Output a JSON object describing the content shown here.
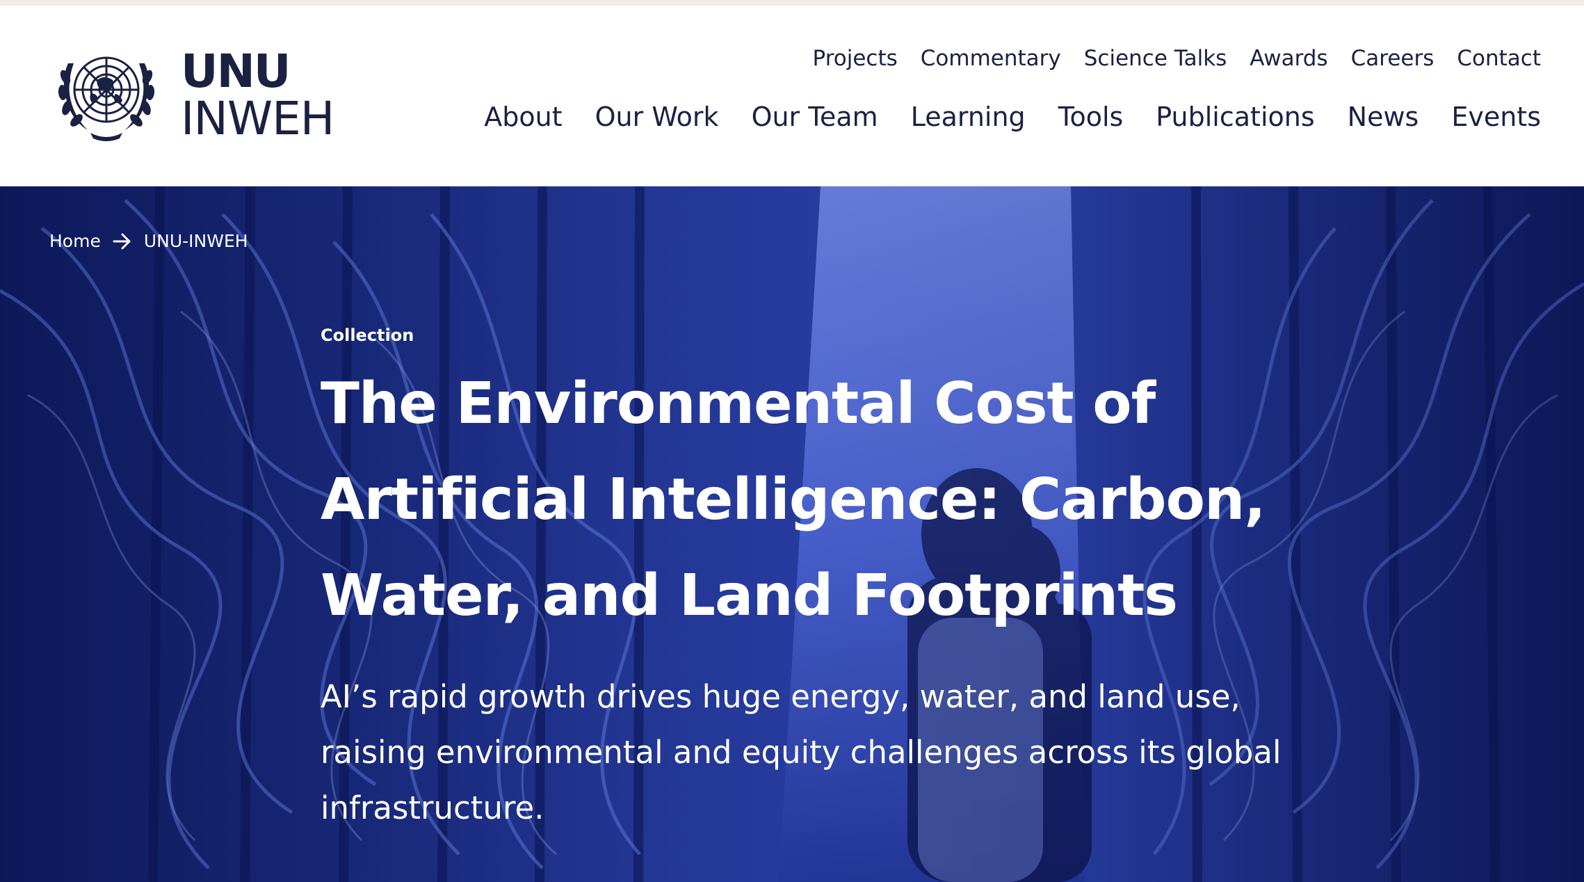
{
  "header": {
    "logo": {
      "line1": "UNU",
      "line2": "INWEH",
      "emblem_icon": "un-emblem-icon"
    },
    "utility_nav": [
      {
        "label": "Projects"
      },
      {
        "label": "Commentary"
      },
      {
        "label": "Science Talks"
      },
      {
        "label": "Awards"
      },
      {
        "label": "Careers"
      },
      {
        "label": "Contact"
      }
    ],
    "main_nav": [
      {
        "label": "About"
      },
      {
        "label": "Our Work"
      },
      {
        "label": "Our Team"
      },
      {
        "label": "Learning"
      },
      {
        "label": "Tools"
      },
      {
        "label": "Publications"
      },
      {
        "label": "News"
      },
      {
        "label": "Events"
      }
    ]
  },
  "hero": {
    "breadcrumb": [
      {
        "label": "Home"
      },
      {
        "label": "UNU-INWEH"
      }
    ],
    "breadcrumb_separator_icon": "arrow-right-icon",
    "eyebrow": "Collection",
    "title": "The Environmental Cost of Artificial Intelligence: Carbon, Water, and Land Footprints",
    "summary": "AI’s rapid growth drives huge energy, water, and land use, raising environmental and equity challenges across its global infrastructure."
  },
  "colors": {
    "navy_text": "#1a2142",
    "hero_blue": "#1b2d86",
    "top_rule": "#f3ece4"
  }
}
